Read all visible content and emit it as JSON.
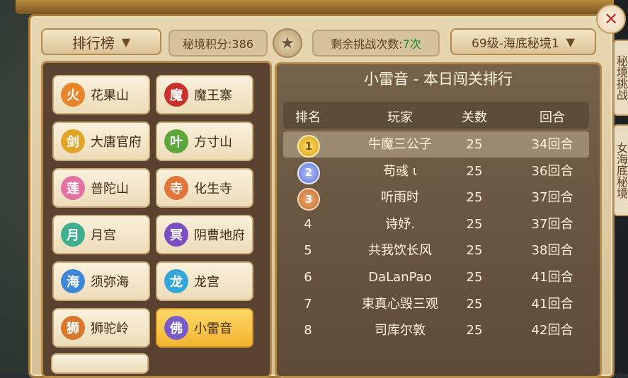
{
  "topbar": {
    "rank_dropdown_label": "排行榜",
    "score_text": "秘境积分:386",
    "remaining_label": "剩余挑战次数:",
    "remaining_value": "7次",
    "level_dropdown_label": "69级-海底秘境1"
  },
  "side_tabs": [
    "秘境挑战",
    "女海底秘境"
  ],
  "maps": [
    {
      "label": "花果山",
      "icon": "flame-icon",
      "color": "#e8842a"
    },
    {
      "label": "魔王寨",
      "icon": "demon-icon",
      "color": "#c8322c"
    },
    {
      "label": "大唐官府",
      "icon": "sword-icon",
      "color": "#e0a528"
    },
    {
      "label": "方寸山",
      "icon": "leaf-icon",
      "color": "#5da63c"
    },
    {
      "label": "普陀山",
      "icon": "lotus-icon",
      "color": "#e470a4"
    },
    {
      "label": "化生寺",
      "icon": "pagoda-icon",
      "color": "#e2753a"
    },
    {
      "label": "月宫",
      "icon": "moon-icon",
      "color": "#3fae8e"
    },
    {
      "label": "阴曹地府",
      "icon": "skull-icon",
      "color": "#7b4fc0"
    },
    {
      "label": "须弥海",
      "icon": "wave-icon",
      "color": "#3f86d8"
    },
    {
      "label": "龙宫",
      "icon": "dragon-icon",
      "color": "#35a6d9"
    },
    {
      "label": "狮驼岭",
      "icon": "lion-icon",
      "color": "#d8782c"
    },
    {
      "label": "小雷音",
      "icon": "buddha-icon",
      "color": "#7a5cc8"
    }
  ],
  "active_map_index": 11,
  "leaderboard": {
    "title": "小雷音 - 本日闯关排行",
    "headers": {
      "rank": "排名",
      "player": "玩家",
      "levels": "关数",
      "rounds": "回合"
    },
    "rows": [
      {
        "rank": "1",
        "player": "牛魔三公子",
        "levels": "25",
        "rounds": "34回合"
      },
      {
        "rank": "2",
        "player": "苟彧 ι",
        "levels": "25",
        "rounds": "36回合"
      },
      {
        "rank": "3",
        "player": "听雨时",
        "levels": "25",
        "rounds": "37回合"
      },
      {
        "rank": "4",
        "player": "诗妤.",
        "levels": "25",
        "rounds": "37回合"
      },
      {
        "rank": "5",
        "player": "共我饮长风",
        "levels": "25",
        "rounds": "38回合"
      },
      {
        "rank": "6",
        "player": "DaLanPao",
        "levels": "25",
        "rounds": "41回合"
      },
      {
        "rank": "7",
        "player": "束真心毁三观",
        "levels": "25",
        "rounds": "41回合"
      },
      {
        "rank": "8",
        "player": "司库尔敦",
        "levels": "25",
        "rounds": "42回合"
      }
    ]
  }
}
